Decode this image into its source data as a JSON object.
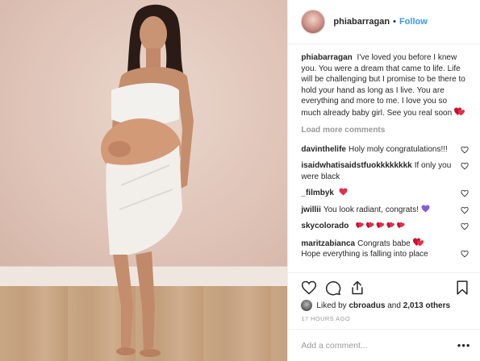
{
  "header": {
    "username": "phiabarragan",
    "separator": "•",
    "follow_label": "Follow"
  },
  "caption": {
    "username": "phiabarragan",
    "text": "I've loved you before I knew you. You were a dream that came to life. Life will be challenging but I promise to be there to hold your hand as long as I live. You are everything and more to me. I love you so much already baby girl. See you real soon"
  },
  "load_more_label": "Load more comments",
  "comments": [
    {
      "username": "davinthelife",
      "text": "Holy moly congratulations!!!"
    },
    {
      "username": "isaidwhatisaidstfuokkkkkkkk",
      "text": "If only you were black"
    },
    {
      "username": "_filmbyk",
      "text": ""
    },
    {
      "username": "jwillii",
      "text": "You look radiant, congrats!"
    },
    {
      "username": "skycolorado",
      "text": ""
    },
    {
      "username": "maritzabianca",
      "text": "Congrats babe"
    },
    {
      "username": "",
      "text": "Hope everything is falling into place"
    }
  ],
  "likes": {
    "prefix": "Liked by",
    "user": "cbroadus",
    "connector": "and",
    "count_text": "2,013 others"
  },
  "timestamp": "17 HOURS AGO",
  "add_comment": {
    "placeholder": "Add a comment...",
    "more": "•••"
  },
  "colors": {
    "accent": "#3897f0",
    "text": "#262626",
    "muted": "#999999",
    "heart": "#c8102e",
    "purple_heart": "#8a5bd6"
  },
  "icons": [
    "heart-icon",
    "comment-icon",
    "share-icon",
    "bookmark-icon",
    "more-options-icon"
  ]
}
